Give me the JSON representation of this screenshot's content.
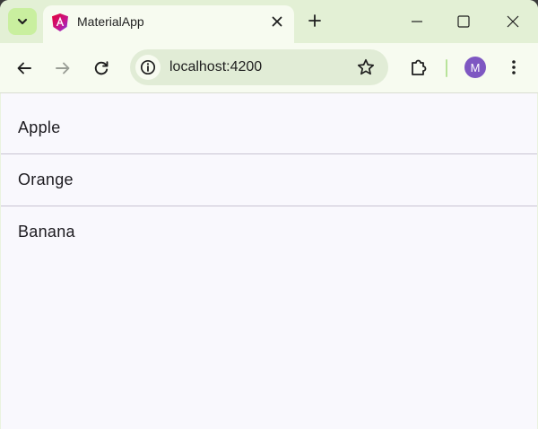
{
  "browser": {
    "tab": {
      "title": "MaterialApp"
    },
    "address_bar": {
      "url": "localhost:4200"
    },
    "profile": {
      "initial": "M",
      "color": "#7e57c2"
    }
  },
  "colors": {
    "accent": "#c9ef9f",
    "toolbar": "#f7fbf0",
    "page_background": "#f9f8fd"
  },
  "list": {
    "items": [
      {
        "label": "Apple"
      },
      {
        "label": "Orange"
      },
      {
        "label": "Banana"
      }
    ]
  },
  "icons": {
    "tab_search": "chevron-down-icon",
    "favicon": "angular-icon",
    "tab_close": "close-icon",
    "new_tab": "plus-icon",
    "back": "arrow-left-icon",
    "forward": "arrow-right-icon",
    "reload": "reload-icon",
    "site_info": "info-icon",
    "bookmark": "star-icon",
    "extensions": "puzzle-icon",
    "menu": "more-vert-icon"
  }
}
